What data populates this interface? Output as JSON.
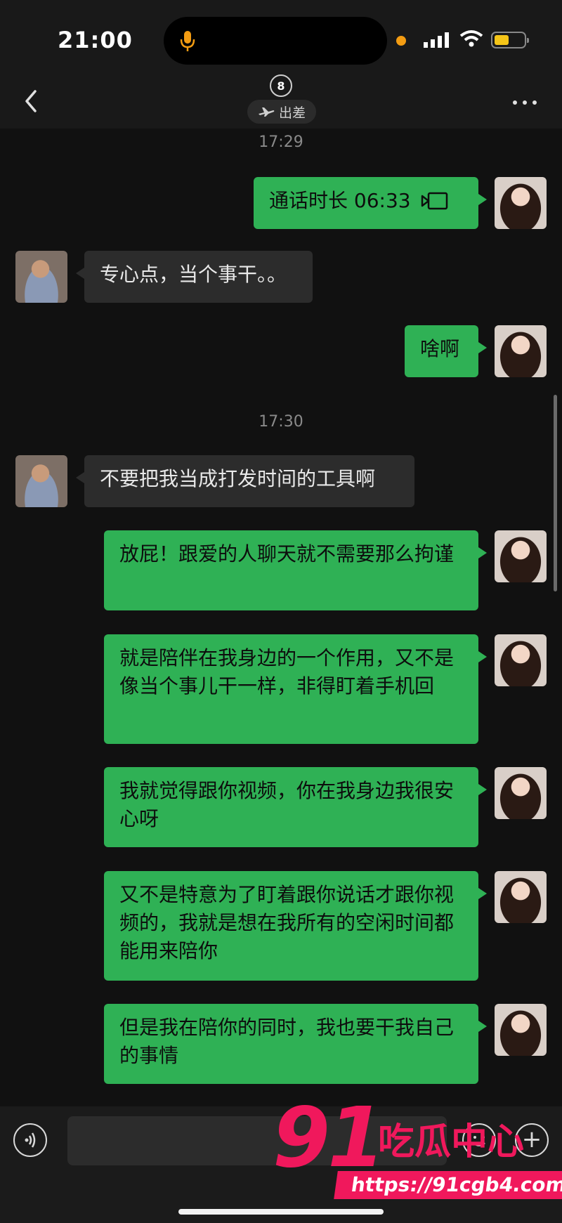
{
  "status_bar": {
    "time": "21:00"
  },
  "header": {
    "contact_icon": "8",
    "status_label": "出差",
    "status_icon": "airplane-icon"
  },
  "messages": [
    {
      "type": "time",
      "text": "17:29"
    },
    {
      "type": "call",
      "from": "me",
      "label": "通话时长 06:33",
      "icon": "video-call-icon"
    },
    {
      "from": "them",
      "text": "专心点，当个事干。。"
    },
    {
      "from": "me",
      "text": "啥啊"
    },
    {
      "type": "time",
      "text": "17:30"
    },
    {
      "from": "them",
      "text": "不要把我当成打发时间的工具啊"
    },
    {
      "from": "me",
      "text": "放屁！跟爱的人聊天就不需要那么拘谨"
    },
    {
      "from": "me",
      "text": "就是陪伴在我身边的一个作用，又不是像当个事儿干一样，非得盯着手机回"
    },
    {
      "from": "me",
      "text": "我就觉得跟你视频，你在我身边我很安心呀"
    },
    {
      "from": "me",
      "text": "又不是特意为了盯着跟你说话才跟你视频的，我就是想在我所有的空闲时间都能用来陪你"
    },
    {
      "from": "me",
      "text": "但是我在陪你的同时，我也要干我自己的事情"
    }
  ],
  "watermark": {
    "number": "91",
    "name": "吃瓜中心",
    "url": "https://91cgb4.com"
  },
  "colors": {
    "my_bubble": "#2fb155",
    "their_bubble": "#2c2c2c",
    "background": "#111111",
    "watermark": "#f0185c"
  }
}
